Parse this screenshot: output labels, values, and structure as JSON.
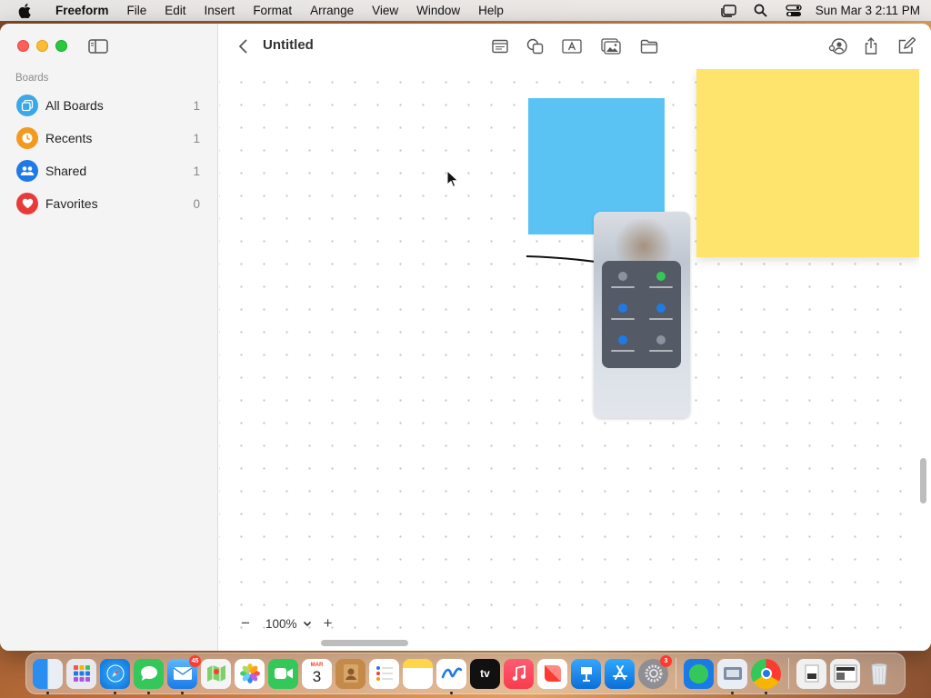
{
  "menubar": {
    "app_name": "Freeform",
    "items": [
      "File",
      "Edit",
      "Insert",
      "Format",
      "Arrange",
      "View",
      "Window",
      "Help"
    ],
    "clock": "Sun Mar 3  2:11 PM"
  },
  "sidebar": {
    "section_label": "Boards",
    "items": [
      {
        "label": "All Boards",
        "count": "1",
        "color": "#3aa7e6"
      },
      {
        "label": "Recents",
        "count": "1",
        "color": "#f29a1f"
      },
      {
        "label": "Shared",
        "count": "1",
        "color": "#1f7ae6"
      },
      {
        "label": "Favorites",
        "count": "0",
        "color": "#e93a3a"
      }
    ]
  },
  "board": {
    "title": "Untitled",
    "zoom": "100%",
    "shape_color": "#5ac3f3",
    "note_color": "#fee36c"
  },
  "dock": {
    "mail_badge": "45",
    "settings_badge": "3",
    "calendar_month": "MAR",
    "calendar_day": "3",
    "tv_label": "tv"
  }
}
